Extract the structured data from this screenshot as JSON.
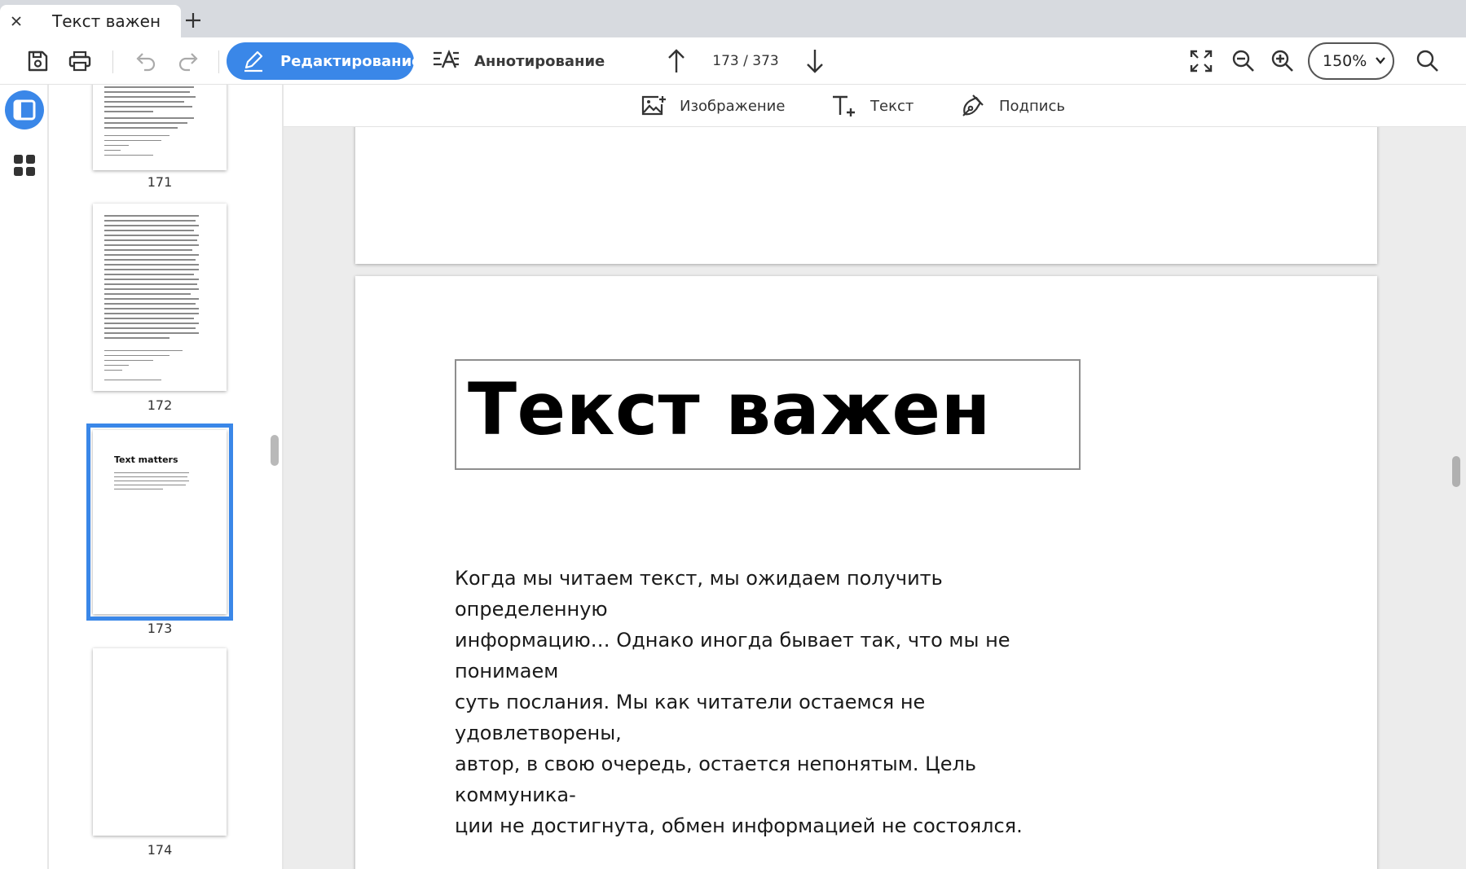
{
  "tab": {
    "title": "Текст важен"
  },
  "toolbar": {
    "edit_label": "Редактирование",
    "annotate_label": "Аннотирование",
    "current_page": "173",
    "page_separator": "/",
    "total_pages": "373",
    "zoom": "150%",
    "accent_color": "#3a87e8"
  },
  "subbar": {
    "image_label": "Изображение",
    "text_label": "Текст",
    "signature_label": "Подпись"
  },
  "thumbnails": [
    {
      "label": "171"
    },
    {
      "label": "172"
    },
    {
      "label": "173",
      "title": "Text matters",
      "selected": true
    },
    {
      "label": "174"
    }
  ],
  "document": {
    "title": "Текст важен",
    "paragraph_lines": [
      "Когда мы читаем текст, мы ожидаем получить определенную",
      "информацию… Однако иногда бывает так, что мы не понимаем",
      "суть послания. Мы как читатели остаемся не удовлетворены,",
      "автор, в свою очередь, остается непонятым. Цель коммуника-",
      "ции не достигнута, обмен информацией не состоялся."
    ]
  }
}
